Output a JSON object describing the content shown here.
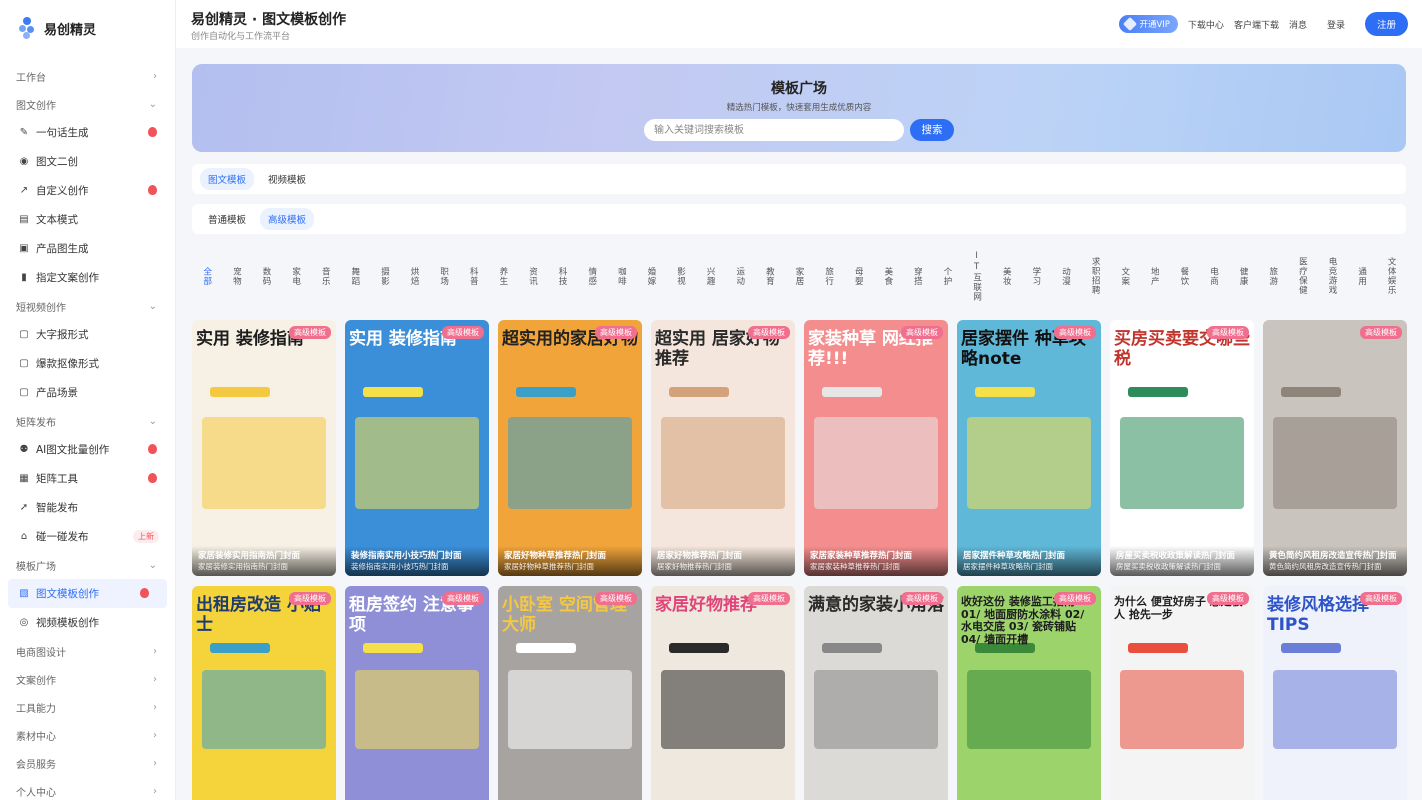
{
  "app": {
    "name": "易创精灵"
  },
  "header": {
    "title": "易创精灵 · 图文模板创作",
    "subtitle": "创作自动化与工作流平台",
    "vip": "开通VIP",
    "links": [
      "下载中心",
      "客户端下载",
      "消息"
    ],
    "login": "登录",
    "register": "注册"
  },
  "sidebar": {
    "workspace": "工作台",
    "groups": [
      {
        "label": "图文创作",
        "items": [
          {
            "label": "一句话生成",
            "icon": "pen-icon",
            "hot": true
          },
          {
            "label": "图文二创",
            "icon": "camera-icon"
          },
          {
            "label": "自定义创作",
            "icon": "share-icon",
            "hot": true
          },
          {
            "label": "文本模式",
            "icon": "doc-icon"
          },
          {
            "label": "产品图生成",
            "icon": "image-icon"
          },
          {
            "label": "指定文案创作",
            "icon": "note-icon"
          }
        ]
      },
      {
        "label": "短视频创作",
        "items": [
          {
            "label": "大字报形式",
            "icon": "frame-icon"
          },
          {
            "label": "爆款抠像形式",
            "icon": "frame-icon"
          },
          {
            "label": "产品场景",
            "icon": "frame-icon"
          }
        ]
      },
      {
        "label": "矩阵发布",
        "items": [
          {
            "label": "AI图文批量创作",
            "icon": "people-icon",
            "hot": true
          },
          {
            "label": "矩阵工具",
            "icon": "grid-icon",
            "hot": true
          },
          {
            "label": "智能发布",
            "icon": "send-icon"
          },
          {
            "label": "碰一碰发布",
            "icon": "home-icon",
            "tag": "上新"
          }
        ]
      },
      {
        "label": "模板广场",
        "items": [
          {
            "label": "图文模板创作",
            "icon": "template-icon",
            "hot": true,
            "active": true
          },
          {
            "label": "视频模板创作",
            "icon": "video-icon"
          }
        ]
      }
    ],
    "collapsed": [
      "电商图设计",
      "文案创作",
      "工具能力",
      "素材中心",
      "会员服务",
      "个人中心"
    ]
  },
  "hero": {
    "title": "模板广场",
    "subtitle": "精选热门模板，快速套用生成优质内容",
    "search_placeholder": "输入关键词搜索模板",
    "search_button": "搜索"
  },
  "tabs": {
    "type": [
      "图文模板",
      "视频模板"
    ],
    "level": [
      "普通模板",
      "高级模板"
    ]
  },
  "categories": [
    "全部",
    "宠物",
    "数码",
    "家电",
    "音乐",
    "舞蹈",
    "摄影",
    "烘焙",
    "职场",
    "科普",
    "养生",
    "资讯",
    "科技",
    "情感",
    "咖啡",
    "婚嫁",
    "影视",
    "兴趣",
    "运动",
    "教育",
    "家居",
    "旅行",
    "母婴",
    "美食",
    "穿搭",
    "个护",
    "IT互联网",
    "美妆",
    "学习",
    "动漫",
    "求职招聘",
    "文案",
    "地产",
    "餐饮",
    "电商",
    "健康",
    "旅游",
    "医疗保健",
    "电竞游戏",
    "通用",
    "文体娱乐"
  ],
  "badge": "高级模板",
  "cards_row1": [
    {
      "big": "实用 装修指南",
      "t1": "家居装修实用指南热门封面",
      "t2": "家居装修实用指南热门封面",
      "bg": "#f6f1e4",
      "fg": "#1d1d1d",
      "acc": "#f5c842"
    },
    {
      "big": "实用 装修指南",
      "t1": "装修指南实用小技巧热门封面",
      "t2": "装修指南实用小技巧热门封面",
      "bg": "#3b8fd9",
      "fg": "#ffffff",
      "acc": "#f5e04a"
    },
    {
      "big": "超实用的家居好物",
      "t1": "家居好物种草推荐热门封面",
      "t2": "家居好物种草推荐热门封面",
      "bg": "#f0a43a",
      "fg": "#222222",
      "acc": "#3aa0c8"
    },
    {
      "big": "超实用 居家好物 推荐",
      "t1": "居家好物推荐热门封面",
      "t2": "居家好物推荐热门封面",
      "bg": "#f4e6dc",
      "fg": "#2a2a2a",
      "acc": "#d4a27a"
    },
    {
      "big": "家装种草 网红推荐!!!",
      "t1": "家居家装种草推荐热门封面",
      "t2": "家居家装种草推荐热门封面",
      "bg": "#f48e8e",
      "fg": "#ffffff",
      "acc": "#e6e6e6"
    },
    {
      "big": "居家摆件 种草攻略note",
      "t1": "居家摆件种草攻略热门封面",
      "t2": "居家摆件种草攻略热门封面",
      "bg": "#5fb8d8",
      "fg": "#111111",
      "acc": "#f5e04a"
    },
    {
      "big": "买房买卖要交哪些税",
      "t1": "房屋买卖税收政策解读热门封面",
      "t2": "房屋买卖税收政策解读热门封面",
      "bg": "#ffffff",
      "fg": "#c2352d",
      "acc": "#2c8c5a"
    },
    {
      "big": "",
      "t1": "黄色简约风租房改造宣传热门封面",
      "t2": "黄色简约风租房改造宣传热门封面",
      "bg": "#c9c4bd",
      "fg": "#ffffff",
      "acc": "#8d847a"
    }
  ],
  "cards_row2": [
    {
      "big": "出租房改造 小贴士",
      "bg": "#f5d33b",
      "fg": "#1f3c6e",
      "acc": "#3aa0c8"
    },
    {
      "big": "租房签约 注意事项",
      "bg": "#8e8fd6",
      "fg": "#ffffff",
      "acc": "#f5e04a"
    },
    {
      "big": "小卧室 空间管理大师",
      "bg": "#a7a3a0",
      "fg": "#f5c842",
      "acc": "#ffffff"
    },
    {
      "big": "家居好物推荐",
      "bg": "#efe8de",
      "fg": "#e0457a",
      "acc": "#2a2a2a"
    },
    {
      "big": "满意的家装小角落",
      "bg": "#dcdad6",
      "fg": "#2a2a2a",
      "acc": "#888888"
    },
    {
      "big": "收好这份 装修监工指南 01/ 地面厨防水涂料 02/ 水电交底 03/ 瓷砖铺贴 04/ 墙面开槽",
      "bg": "#9cd36b",
      "fg": "#1d1d1d",
      "acc": "#3a8a3a"
    },
    {
      "big": "为什么 便宜好房子 总是被人 抢先一步",
      "bg": "#f4f4f4",
      "fg": "#1d1d1d",
      "acc": "#e94f3c"
    },
    {
      "big": "装修风格选择TIPS",
      "bg": "#f0f2fb",
      "fg": "#2e55c8",
      "acc": "#6a7ed8"
    }
  ]
}
